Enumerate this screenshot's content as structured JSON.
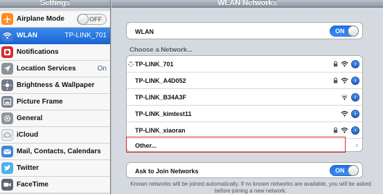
{
  "sidebar": {
    "title": "Settings",
    "items": [
      {
        "label": "Airplane Mode",
        "value": "OFF"
      },
      {
        "label": "WLAN",
        "value": "TP-LINK_701"
      },
      {
        "label": "Notifications",
        "value": ""
      },
      {
        "label": "Location Services",
        "value": "On"
      },
      {
        "label": "Brightness & Wallpaper",
        "value": ""
      },
      {
        "label": "Picture Frame",
        "value": ""
      },
      {
        "label": "General",
        "value": ""
      },
      {
        "label": "iCloud",
        "value": ""
      },
      {
        "label": "Mail, Contacts, Calendars",
        "value": ""
      },
      {
        "label": "Twitter",
        "value": ""
      },
      {
        "label": "FaceTime",
        "value": ""
      }
    ]
  },
  "main": {
    "title": "WLAN Networks",
    "wlan_label": "WLAN",
    "wlan_toggle": "ON",
    "choose_label": "Choose a Network...",
    "networks": [
      {
        "name": "TP-LINK_701",
        "locked": true,
        "connected": true
      },
      {
        "name": "TP-LINK_A4D052",
        "locked": true
      },
      {
        "name": "TP-LINK_B34A3F",
        "locked": false
      },
      {
        "name": "TP-LINK_kimtest11",
        "locked": false
      },
      {
        "name": "TP-LINK_xiaoran",
        "locked": true
      }
    ],
    "other_label": "Other...",
    "ask_label": "Ask to Join Networks",
    "ask_toggle": "ON",
    "footnote": "Known networks will be joined automatically.  If no known networks are available, you will be asked before joining a new network."
  },
  "colors": {
    "selection_blue": "#2a73e0",
    "toggle_on_blue": "#2b7ff0",
    "highlight_red": "#e02020"
  }
}
